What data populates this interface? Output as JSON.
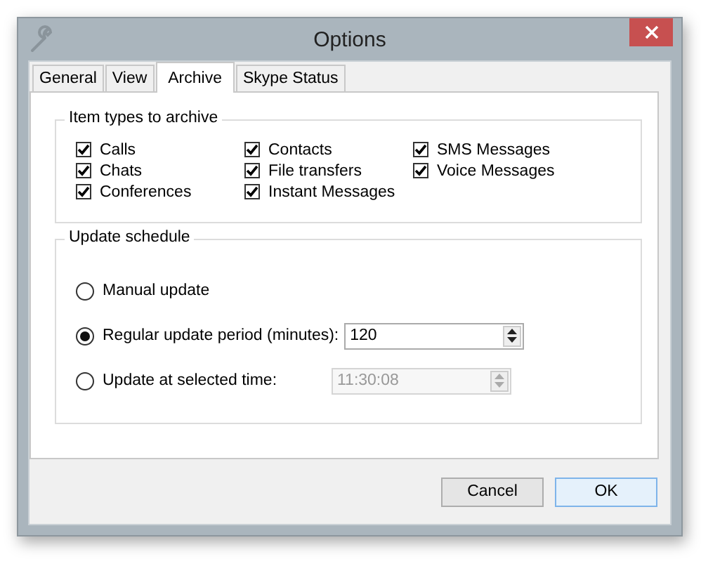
{
  "window": {
    "title": "Options"
  },
  "tabs": [
    {
      "label": "General",
      "selected": false
    },
    {
      "label": "View",
      "selected": false
    },
    {
      "label": "Archive",
      "selected": true
    },
    {
      "label": "Skype Status",
      "selected": false
    }
  ],
  "item_types": {
    "title": "Item types to archive",
    "columns": [
      [
        {
          "label": "Calls",
          "checked": true
        },
        {
          "label": "Chats",
          "checked": true
        },
        {
          "label": "Conferences",
          "checked": true
        }
      ],
      [
        {
          "label": "Contacts",
          "checked": true
        },
        {
          "label": "File transfers",
          "checked": true
        },
        {
          "label": "Instant Messages",
          "checked": true
        }
      ],
      [
        {
          "label": "SMS Messages",
          "checked": true
        },
        {
          "label": "Voice Messages",
          "checked": true
        }
      ]
    ]
  },
  "update_schedule": {
    "title": "Update schedule",
    "options": [
      {
        "label": "Manual update",
        "selected": false
      },
      {
        "label": "Regular update period (minutes):",
        "selected": true,
        "field": {
          "value": "120",
          "disabled": false
        }
      },
      {
        "label": "Update at selected time:",
        "selected": false,
        "field": {
          "value": "11:30:08",
          "disabled": true
        }
      }
    ]
  },
  "buttons": [
    {
      "label": "Cancel",
      "default": false
    },
    {
      "label": "OK",
      "default": true
    }
  ]
}
